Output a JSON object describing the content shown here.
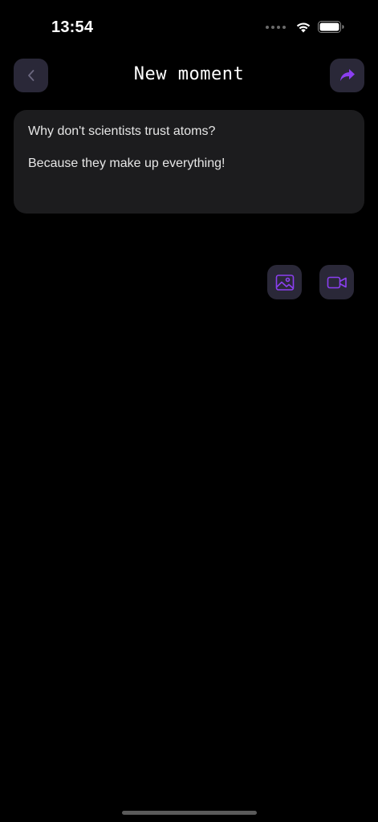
{
  "status_bar": {
    "time": "13:54"
  },
  "header": {
    "title": "New moment",
    "back_icon": "chevron-left-icon",
    "share_icon": "share-forward-icon"
  },
  "note": {
    "line1": "Why don't scientists trust atoms?",
    "line2": "Because they make up everything!"
  },
  "media": {
    "photo_icon": "image-icon",
    "video_icon": "video-camera-icon"
  },
  "colors": {
    "accent": "#8b3ff0",
    "background": "#000000",
    "card": "#1c1c1e",
    "button": "#2a2838"
  }
}
